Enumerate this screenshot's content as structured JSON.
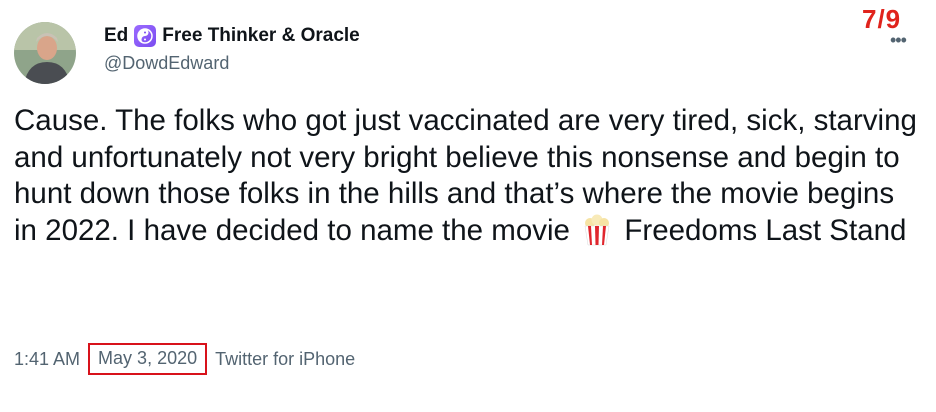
{
  "header": {
    "display_name": "Ed",
    "bio_title": "Free Thinker & Oracle",
    "handle": "@DowdEdward",
    "thread_counter": "7/9",
    "more_glyph": "•••"
  },
  "tweet": {
    "text_before_emoji": "Cause. The folks who got just vaccinated are very tired, sick, starving and unfortunately not very bright believe this nonsense and begin to hunt down those folks in the hills and that’s where the movie begins in 2022. I have decided to name the movie",
    "emoji_name": "popcorn-icon",
    "text_after_emoji": "Freedoms Last Stand"
  },
  "meta": {
    "time": "1:41 AM",
    "date": "May 3, 2020",
    "source": "Twitter for iPhone"
  },
  "colors": {
    "counter": "#e0231c",
    "highlight_box": "#d8121b",
    "muted_text": "#536471",
    "badge": "#8a5cf5"
  }
}
